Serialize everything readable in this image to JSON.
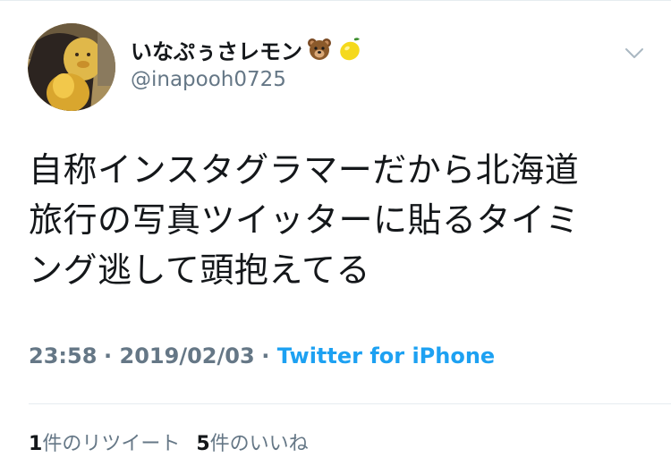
{
  "user": {
    "display_name": "いなぷぅさレモン",
    "emojis": [
      "bear-face-icon",
      "lemon-icon"
    ],
    "handle": "@inapooh0725"
  },
  "tweet": {
    "lines": [
      "自称インスタグラマーだから北海道",
      "旅行の写真ツイッターに貼るタイミ",
      "ング逃して頭抱えてる"
    ]
  },
  "meta": {
    "time": "23:58",
    "separator": "·",
    "date": "2019/02/03",
    "source": "Twitter for iPhone"
  },
  "stats": {
    "retweets_count": "1",
    "retweets_label": "件のリツイート",
    "likes_count": "5",
    "likes_label": "件のいいね"
  },
  "colors": {
    "text": "#14171a",
    "secondary": "#657786",
    "link": "#1da1f2",
    "border": "#e6ecf0"
  }
}
